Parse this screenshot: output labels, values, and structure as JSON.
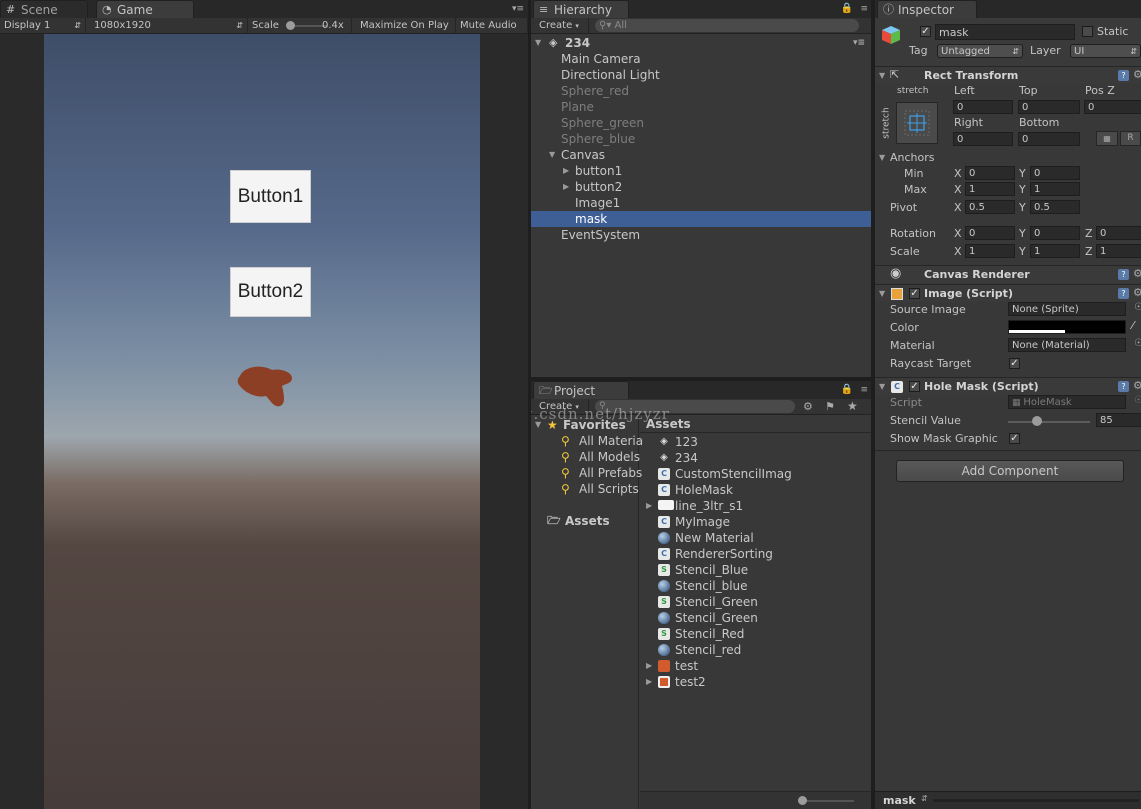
{
  "game_panel": {
    "tabs": [
      {
        "label": "Scene",
        "icon": "grid-icon"
      },
      {
        "label": "Game",
        "icon": "pacman-icon"
      }
    ],
    "toolbar": {
      "display": "Display 1",
      "resolution": "1080x1920",
      "scale_label": "Scale",
      "scale_value": "0.4x",
      "maximize": "Maximize On Play",
      "mute": "Mute Audio"
    },
    "buttons": [
      "Button1",
      "Button2"
    ]
  },
  "hierarchy": {
    "tab": "Hierarchy",
    "create": "Create",
    "search_placeholder": "All",
    "scene": "234",
    "items": [
      {
        "label": "Main Camera",
        "indent": 0,
        "dim": false,
        "arrow": ""
      },
      {
        "label": "Directional Light",
        "indent": 0,
        "dim": false,
        "arrow": ""
      },
      {
        "label": "Sphere_red",
        "indent": 0,
        "dim": true,
        "arrow": ""
      },
      {
        "label": "Plane",
        "indent": 0,
        "dim": true,
        "arrow": ""
      },
      {
        "label": "Sphere_green",
        "indent": 0,
        "dim": true,
        "arrow": ""
      },
      {
        "label": "Sphere_blue",
        "indent": 0,
        "dim": true,
        "arrow": ""
      },
      {
        "label": "Canvas",
        "indent": 0,
        "dim": false,
        "arrow": "open"
      },
      {
        "label": "button1",
        "indent": 1,
        "dim": false,
        "arrow": "closed"
      },
      {
        "label": "button2",
        "indent": 1,
        "dim": false,
        "arrow": "closed"
      },
      {
        "label": "Image1",
        "indent": 1,
        "dim": false,
        "arrow": ""
      },
      {
        "label": "mask",
        "indent": 1,
        "dim": false,
        "arrow": "",
        "selected": true
      },
      {
        "label": "EventSystem",
        "indent": 0,
        "dim": false,
        "arrow": ""
      }
    ]
  },
  "project": {
    "tab": "Project",
    "create": "Create",
    "favorites_title": "Favorites",
    "favorites": [
      "All Materia",
      "All Models",
      "All Prefabs",
      "All Scripts"
    ],
    "assets_root": "Assets",
    "assets_header": "Assets",
    "assets": [
      {
        "label": "123",
        "icon": "scene"
      },
      {
        "label": "234",
        "icon": "scene"
      },
      {
        "label": "CustomStencilImag",
        "icon": "script"
      },
      {
        "label": "HoleMask",
        "icon": "script"
      },
      {
        "label": "line_3ltr_s1",
        "icon": "tex-white",
        "arrow": true
      },
      {
        "label": "MyImage",
        "icon": "script"
      },
      {
        "label": "New Material",
        "icon": "mat"
      },
      {
        "label": "RendererSorting",
        "icon": "script"
      },
      {
        "label": "Stencil_Blue",
        "icon": "shader"
      },
      {
        "label": "Stencil_blue",
        "icon": "mat"
      },
      {
        "label": "Stencil_Green",
        "icon": "shader"
      },
      {
        "label": "Stencil_Green",
        "icon": "mat"
      },
      {
        "label": "Stencil_Red",
        "icon": "shader"
      },
      {
        "label": "Stencil_red",
        "icon": "mat"
      },
      {
        "label": "test",
        "icon": "tex-orange",
        "arrow": true
      },
      {
        "label": "test2",
        "icon": "tex-orange2",
        "arrow": true
      }
    ],
    "watermark": "http://blog.csdn.net/hjzyzr"
  },
  "inspector": {
    "tab": "Inspector",
    "object_name": "mask",
    "static_label": "Static",
    "tag_label": "Tag",
    "tag_value": "Untagged",
    "layer_label": "Layer",
    "layer_value": "UI",
    "rect_transform": {
      "title": "Rect Transform",
      "stretch_h": "stretch",
      "stretch_v": "stretch",
      "left_label": "Left",
      "left": "0",
      "top_label": "Top",
      "top": "0",
      "posz_label": "Pos Z",
      "posz": "0",
      "right_label": "Right",
      "right": "0",
      "bottom_label": "Bottom",
      "bottom": "0",
      "r_button": "R",
      "anchors_label": "Anchors",
      "min_label": "Min",
      "min_x": "0",
      "min_y": "0",
      "max_label": "Max",
      "max_x": "1",
      "max_y": "1",
      "pivot_label": "Pivot",
      "pivot_x": "0.5",
      "pivot_y": "0.5",
      "rotation_label": "Rotation",
      "rot_x": "0",
      "rot_y": "0",
      "rot_z": "0",
      "scale_label": "Scale",
      "scale_x": "1",
      "scale_y": "1",
      "scale_z": "1",
      "x": "X",
      "y": "Y",
      "z": "Z"
    },
    "canvas_renderer": {
      "title": "Canvas Renderer"
    },
    "image": {
      "title": "Image (Script)",
      "source_label": "Source Image",
      "source_value": "None (Sprite)",
      "color_label": "Color",
      "material_label": "Material",
      "material_value": "None (Material)",
      "raycast_label": "Raycast Target"
    },
    "hole_mask": {
      "title": "Hole Mask (Script)",
      "script_label": "Script",
      "script_value": "HoleMask",
      "stencil_label": "Stencil Value",
      "stencil_value": "85",
      "show_label": "Show Mask Graphic"
    },
    "add_component": "Add Component",
    "footer_label": "mask"
  }
}
